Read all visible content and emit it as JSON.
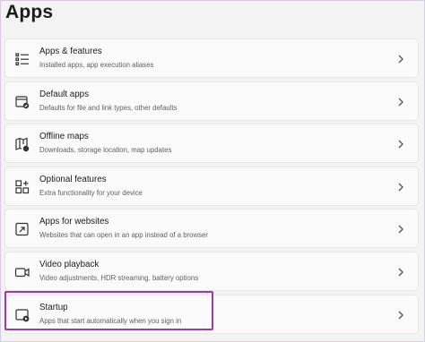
{
  "page": {
    "title": "Apps"
  },
  "items": [
    {
      "title": "Apps & features",
      "description": "Installed apps, app execution aliases",
      "icon": "apps-features-icon"
    },
    {
      "title": "Default apps",
      "description": "Defaults for file and link types, other defaults",
      "icon": "default-apps-icon"
    },
    {
      "title": "Offline maps",
      "description": "Downloads, storage location, map updates",
      "icon": "offline-maps-icon"
    },
    {
      "title": "Optional features",
      "description": "Extra functionality for your device",
      "icon": "optional-features-icon"
    },
    {
      "title": "Apps for websites",
      "description": "Websites that can open in an app instead of a browser",
      "icon": "apps-for-websites-icon"
    },
    {
      "title": "Video playback",
      "description": "Video adjustments, HDR streaming, battery options",
      "icon": "video-playback-icon"
    },
    {
      "title": "Startup",
      "description": "Apps that start automatically when you sign in",
      "icon": "startup-icon"
    }
  ],
  "highlight": {
    "target": "Startup",
    "color": "#9b3ca8"
  }
}
